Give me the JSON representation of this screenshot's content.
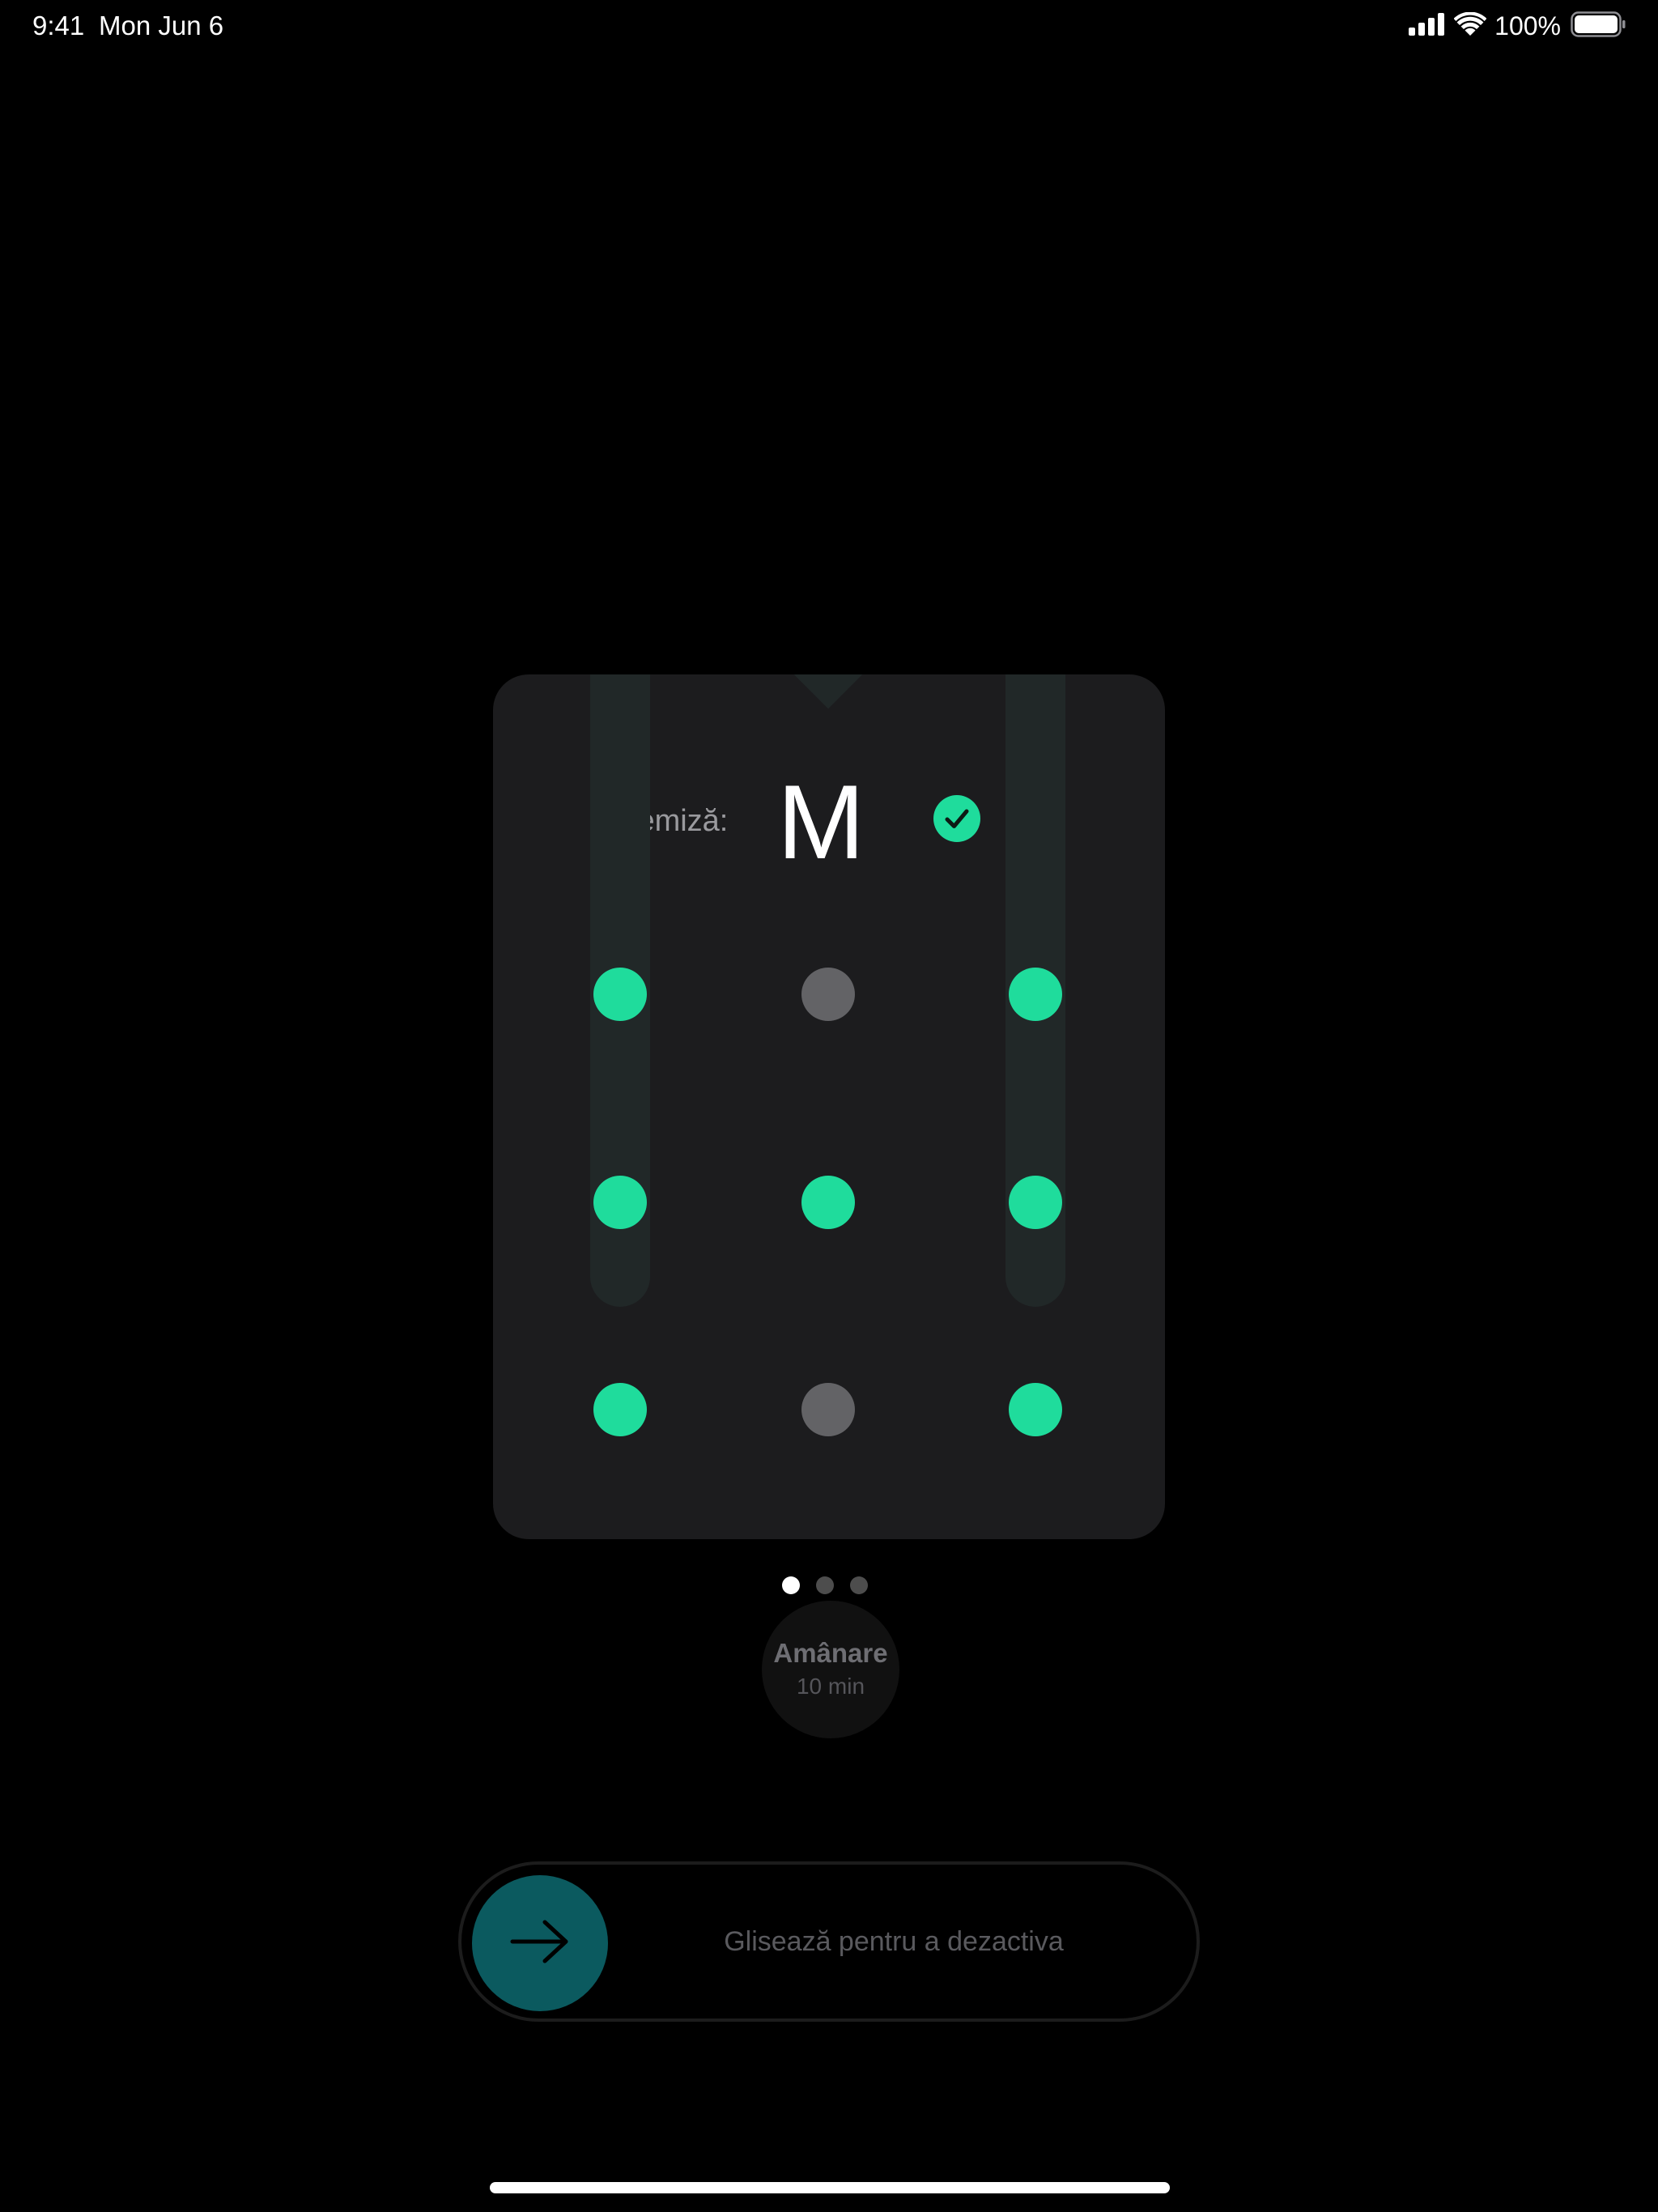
{
  "status_bar": {
    "time": "9:41",
    "date": "Mon Jun 6",
    "battery_percent": "100%",
    "icons": [
      "cellular-signal-icon",
      "wifi-icon",
      "battery-icon"
    ]
  },
  "card": {
    "label": "Remiză:",
    "value": "M",
    "status_icon": "checkmark-icon",
    "pattern": {
      "grid": [
        3,
        3
      ],
      "active_nodes": [
        [
          0,
          0
        ],
        [
          1,
          0
        ],
        [
          2,
          0
        ],
        [
          1,
          1
        ],
        [
          0,
          2
        ],
        [
          1,
          2
        ],
        [
          2,
          2
        ]
      ],
      "inactive_nodes": [
        [
          0,
          1
        ],
        [
          2,
          1
        ]
      ],
      "path": [
        [
          2,
          0
        ],
        [
          1,
          0
        ],
        [
          0,
          0
        ],
        [
          1,
          1
        ],
        [
          0,
          2
        ],
        [
          1,
          2
        ],
        [
          2,
          2
        ]
      ]
    }
  },
  "pagination": {
    "count": 3,
    "active_index": 0
  },
  "snooze": {
    "title": "Amânare",
    "subtitle": "10 min"
  },
  "slider": {
    "label": "Glisează pentru a dezactiva",
    "knob_icon": "arrow-right-icon"
  },
  "colors": {
    "accent": "#1fdc9c",
    "inactive_node": "#636366",
    "card_background": "#1c1c1e",
    "path_trail": "#212828",
    "knob": "#0b5a5f"
  }
}
